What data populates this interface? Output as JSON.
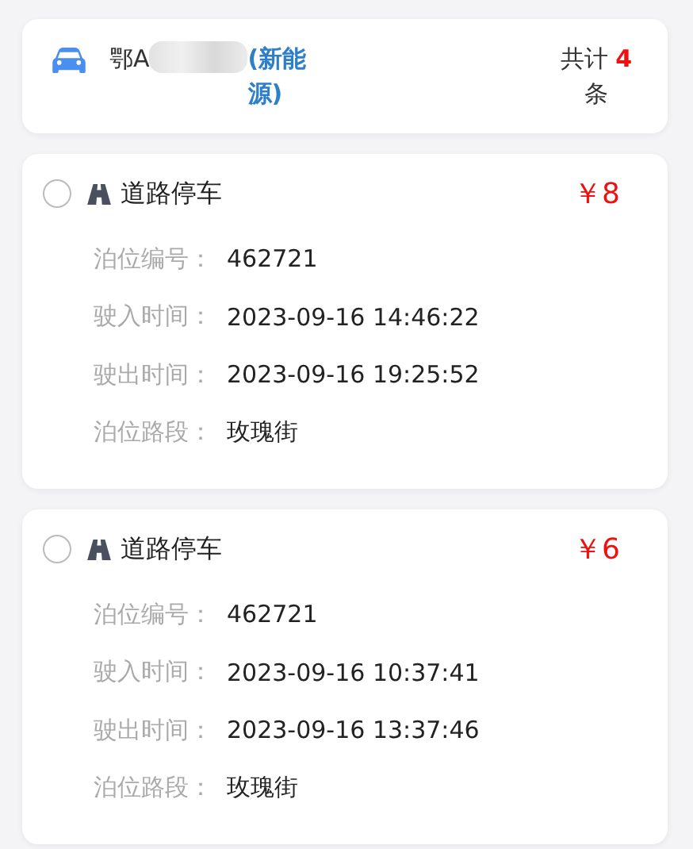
{
  "header": {
    "plate": "鄂A",
    "energy": "(新能源)",
    "total_label": "共计",
    "total_count": "4",
    "total_unit": "条"
  },
  "records": [
    {
      "selected": false,
      "type": "道路停车",
      "price": "￥8",
      "fields": [
        {
          "label": "泊位编号：",
          "value": "462721"
        },
        {
          "label": "驶入时间：",
          "value": "2023-09-16 14:46:22"
        },
        {
          "label": "驶出时间：",
          "value": "2023-09-16 19:25:52"
        },
        {
          "label": "泊位路段：",
          "value": "玫瑰街"
        }
      ]
    },
    {
      "selected": false,
      "type": "道路停车",
      "price": "￥6",
      "fields": [
        {
          "label": "泊位编号：",
          "value": "462721"
        },
        {
          "label": "驶入时间：",
          "value": "2023-09-16 10:37:41"
        },
        {
          "label": "驶出时间：",
          "value": "2023-09-16 13:37:46"
        },
        {
          "label": "泊位路段：",
          "value": "玫瑰街"
        }
      ]
    }
  ]
}
